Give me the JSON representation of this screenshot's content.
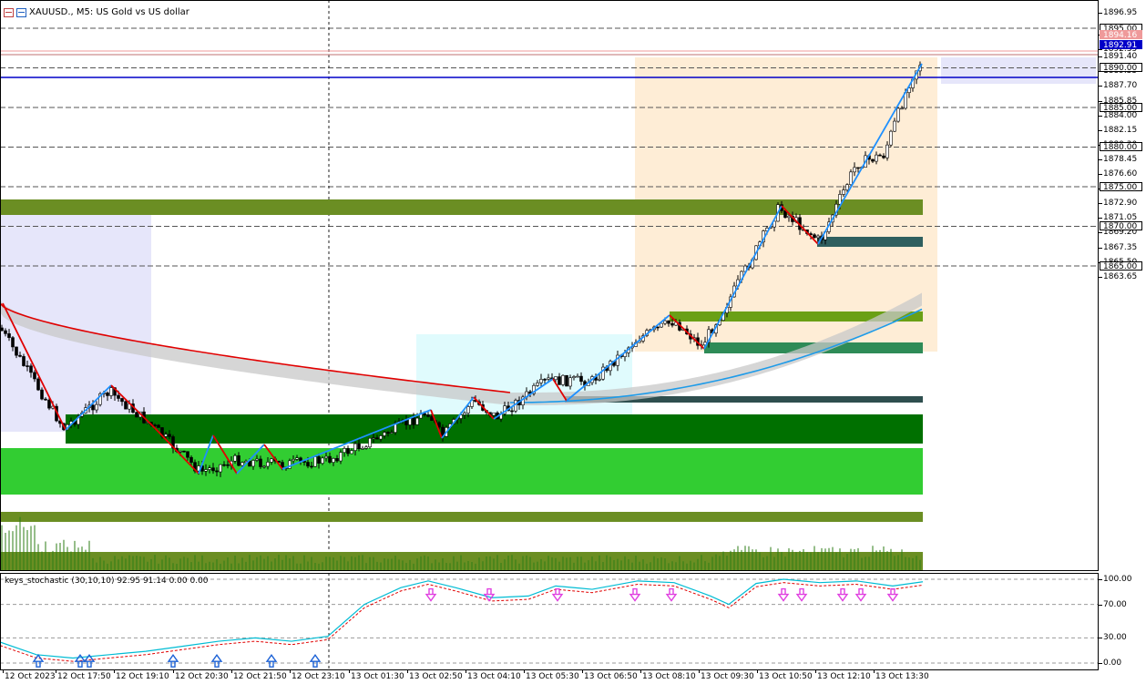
{
  "header": {
    "title": "XAUUSD., M5:  US Gold vs US dollar",
    "icons": [
      "chart-type-icon",
      "indicator-list-icon"
    ]
  },
  "price_axis": {
    "labels": [
      "1896.95",
      "1894.18",
      "1892.35",
      "1891.40",
      "1889.55",
      "1887.70",
      "1885.85",
      "1884.00",
      "1882.15",
      "1880.30",
      "1878.45",
      "1876.60",
      "1874.75",
      "1872.90",
      "1871.05",
      "1869.20",
      "1867.35",
      "1865.50",
      "1863.65"
    ],
    "tags": [
      {
        "text": "1895.00",
        "bg": "#ffffff",
        "fg": "#000000",
        "border": "#000000"
      },
      {
        "text": "1894.16",
        "bg": "#ef9a9a",
        "fg": "#ffffff",
        "border": "#ef9a9a"
      },
      {
        "text": "1892.91",
        "bg": "#0000c8",
        "fg": "#ffffff",
        "border": "#0000c8"
      },
      {
        "text": "1890.00",
        "bg": "#ffffff",
        "fg": "#000000",
        "border": "#000000"
      },
      {
        "text": "1885.00",
        "bg": "#ffffff",
        "fg": "#000000",
        "border": "#000000"
      },
      {
        "text": "1880.00",
        "bg": "#ffffff",
        "fg": "#000000",
        "border": "#000000"
      },
      {
        "text": "1875.00",
        "bg": "#ffffff",
        "fg": "#000000",
        "border": "#000000"
      },
      {
        "text": "1870.00",
        "bg": "#ffffff",
        "fg": "#000000",
        "border": "#000000"
      },
      {
        "text": "1865.00",
        "bg": "#ffffff",
        "fg": "#000000",
        "border": "#000000"
      }
    ]
  },
  "oscillator": {
    "label": "keys_stochastic (30,10,10) 92.95 91.14 0.00 0.00",
    "axis_labels": [
      "100.00",
      "70.00",
      "30.00",
      "0.00"
    ]
  },
  "time_axis": {
    "labels": [
      "12 Oct 2023",
      "12 Oct 17:50",
      "12 Oct 19:10",
      "12 Oct 20:30",
      "12 Oct 21:50",
      "12 Oct 23:10",
      "13 Oct 01:30",
      "13 Oct 02:50",
      "13 Oct 04:10",
      "13 Oct 05:30",
      "13 Oct 06:50",
      "13 Oct 08:10",
      "13 Oct 09:30",
      "13 Oct 10:50",
      "13 Oct 12:10",
      "13 Oct 13:30"
    ]
  },
  "colors": {
    "bid_line": "#0000c8",
    "ask_line": "#ef9a9a",
    "demand_zone": "#32cd32",
    "dark_zone": "#007000",
    "olive_zone": "#6b8e23",
    "zigzag_up": "#1e90ff",
    "zigzag_down": "#e00000",
    "moving_average": "#e00000",
    "stoch_main": "#00bcd4",
    "stoch_signal": "#e00000",
    "up_arrow": "#1e63d6",
    "down_arrow": "#e040e0"
  }
}
